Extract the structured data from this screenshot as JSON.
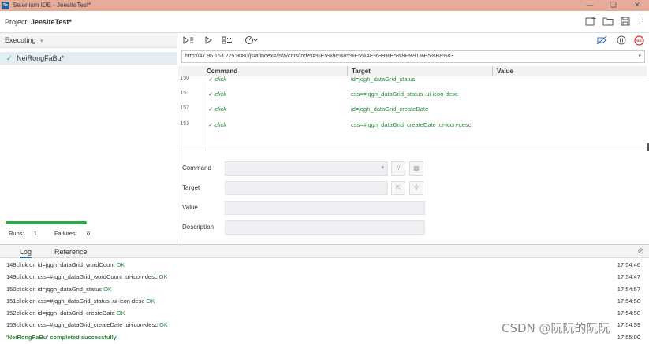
{
  "window": {
    "app_icon": "Se",
    "title": "Selenium IDE - JeesiteTest*",
    "controls": [
      "minimize-icon",
      "restore-icon",
      "close-icon"
    ]
  },
  "project": {
    "label": "Project:",
    "name": "JeesiteTest*",
    "toolbar_icons": [
      "new-suite-icon",
      "open-folder-icon",
      "save-icon",
      "more-icon"
    ]
  },
  "sidebar": {
    "dropdown_label": "Executing",
    "items": [
      {
        "label": "NeiRongFaBu*",
        "status": "passed"
      }
    ],
    "progress": 1.0,
    "runs_label": "Runs:",
    "runs_value": "1",
    "failures_label": "Failures:",
    "failures_value": "0"
  },
  "toolbar": {
    "icons": [
      "run-all-icon",
      "run-current-icon",
      "step-icon",
      "speed-icon",
      "disable-breakpoints-icon",
      "pause-icon",
      "record-icon"
    ],
    "record_label": "REC"
  },
  "url": {
    "value": "http://47.96.163.225:8080/js/a/index#/js/a/cms/index#%E5%86%85%E5%AE%B9%E5%8F%91%E5%B8%83"
  },
  "table": {
    "headers": [
      "Command",
      "Target",
      "Value"
    ],
    "rows": [
      {
        "num": "150",
        "command": "click",
        "target": "id=jqgh_dataGrid_status",
        "value": ""
      },
      {
        "num": "151",
        "command": "click",
        "target": "css=#jqgh_dataGrid_status .ui-icon-desc",
        "value": ""
      },
      {
        "num": "152",
        "command": "click",
        "target": "id=jqgh_dataGrid_createDate",
        "value": ""
      },
      {
        "num": "153",
        "command": "click",
        "target": "css=#jqgh_dataGrid_createDate .ui-icon-desc",
        "value": ""
      }
    ]
  },
  "editor": {
    "command_label": "Command",
    "target_label": "Target",
    "value_label": "Value",
    "description_label": "Description",
    "command_value": "",
    "target_value": "",
    "value_value": "",
    "description_value": ""
  },
  "log": {
    "tabs": [
      "Log",
      "Reference"
    ],
    "active_tab": "Log",
    "lines": [
      {
        "text": "148click on id=jqgh_dataGrid_wordCount",
        "status": "OK",
        "time": "17:54:46"
      },
      {
        "text": "149click on css=#jqgh_dataGrid_wordCount .ui-icon-desc",
        "status": "OK",
        "time": "17:54:47"
      },
      {
        "text": "150click on id=jqgh_dataGrid_status",
        "status": "OK",
        "time": "17:54:57"
      },
      {
        "text": "151click on css=#jqgh_dataGrid_status .ui-icon-desc",
        "status": "OK",
        "time": "17:54:58"
      },
      {
        "text": "152click on id=jqgh_dataGrid_createDate",
        "status": "OK",
        "time": "17:54:58"
      },
      {
        "text": "153click on css=#jqgh_dataGrid_createDate .ui-icon-desc",
        "status": "OK",
        "time": "17:54:59"
      }
    ],
    "success_message": "'NeiRongFaBu' completed successfully",
    "success_time": "17:55:00"
  },
  "watermark": "CSDN @阮阮的阮阮"
}
